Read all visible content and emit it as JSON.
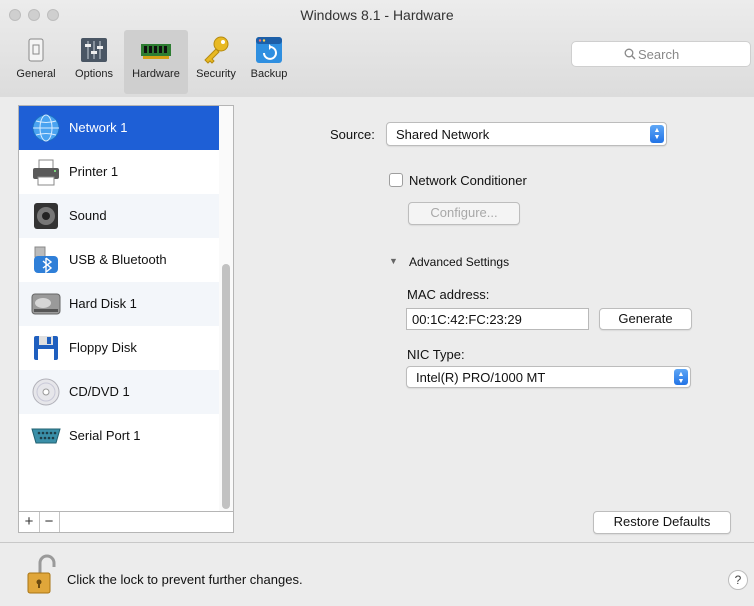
{
  "window": {
    "title": "Windows 8.1 - Hardware"
  },
  "toolbar": {
    "items": [
      {
        "label": "General",
        "icon": "general-icon"
      },
      {
        "label": "Options",
        "icon": "options-icon"
      },
      {
        "label": "Hardware",
        "icon": "hardware-icon",
        "selected": true
      },
      {
        "label": "Security",
        "icon": "key-icon"
      },
      {
        "label": "Backup",
        "icon": "backup-icon"
      }
    ],
    "search_placeholder": "Search"
  },
  "devices": [
    {
      "label": "Network 1",
      "icon": "network-globe-icon",
      "selected": true
    },
    {
      "label": "Printer 1",
      "icon": "printer-icon"
    },
    {
      "label": "Sound",
      "icon": "speaker-icon"
    },
    {
      "label": "USB & Bluetooth",
      "icon": "usb-bluetooth-icon"
    },
    {
      "label": "Hard Disk 1",
      "icon": "hard-disk-icon"
    },
    {
      "label": "Floppy Disk",
      "icon": "floppy-disk-icon"
    },
    {
      "label": "CD/DVD 1",
      "icon": "cd-dvd-icon"
    },
    {
      "label": "Serial Port 1",
      "icon": "serial-port-icon"
    }
  ],
  "list_controls": {
    "add": "+",
    "remove": "−"
  },
  "settings": {
    "source_label": "Source:",
    "source_value": "Shared Network",
    "conditioner_label": "Network Conditioner",
    "conditioner_checked": false,
    "configure_label": "Configure...",
    "advanced_label": "Advanced Settings",
    "mac_label": "MAC address:",
    "mac_value": "00:1C:42:FC:23:29",
    "generate_label": "Generate",
    "nic_label": "NIC Type:",
    "nic_value": "Intel(R) PRO/1000 MT",
    "restore_label": "Restore Defaults"
  },
  "footer": {
    "lock_text": "Click the lock to prevent further changes.",
    "help_label": "?"
  },
  "colors": {
    "selection": "#1e5fd6",
    "popup_arrow": "#2273e6"
  }
}
